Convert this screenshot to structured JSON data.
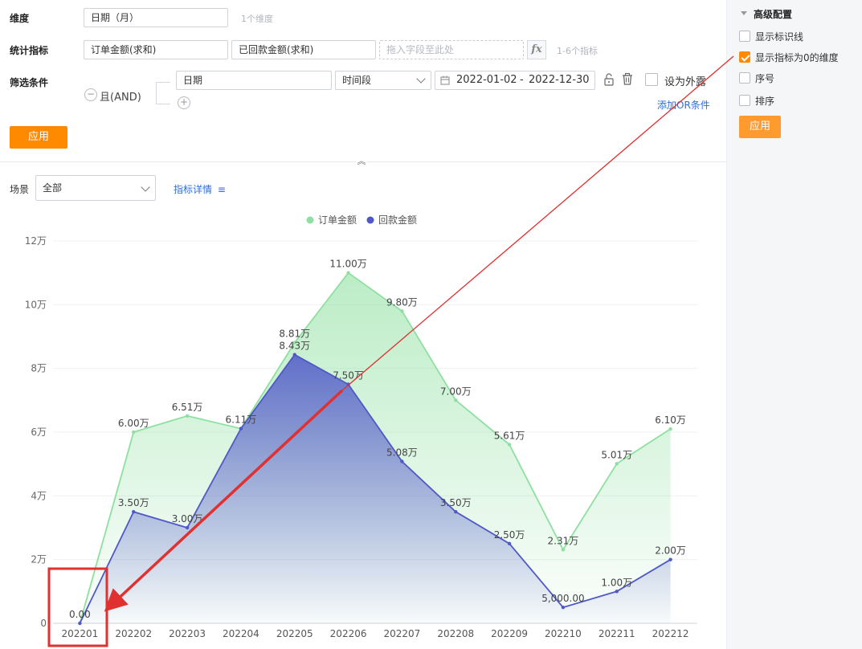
{
  "config": {
    "dimension_label": "维度",
    "dimension_value": "日期（月）",
    "dimension_hint": "1个维度",
    "metric_label": "统计指标",
    "metrics": [
      "订单金额(求和)",
      "已回款金额(求和)"
    ],
    "metric_drop_placeholder": "拖入字段至此处",
    "fx_label": "fx",
    "metric_hint": "1-6个指标",
    "filter_label": "筛选条件",
    "and_label": "且(AND)",
    "minus_symbol": "−",
    "plus_symbol": "+",
    "filter_field": "日期",
    "filter_op": "时间段",
    "date_start": "2022-01-02",
    "date_sep": "-",
    "date_end": "2022-12-30",
    "expose_label": "设为外露",
    "add_or_label": "添加OR条件",
    "apply_label": "应用",
    "collapse_symbol": "︽"
  },
  "toolbar": {
    "scene_label": "场景",
    "scene_value": "全部",
    "metric_detail_label": "指标详情",
    "metric_detail_icon": "≡"
  },
  "advanced": {
    "title": "高级配置",
    "options": [
      {
        "label": "显示标识线",
        "checked": false
      },
      {
        "label": "显示指标为0的维度",
        "checked": true
      },
      {
        "label": "序号",
        "checked": false
      },
      {
        "label": "排序",
        "checked": false
      }
    ],
    "apply_label": "应用"
  },
  "colors": {
    "accent": "#ff8a00",
    "series_green": "#8ee0a0",
    "series_blue": "#5058c8",
    "annotation_red": "#e03030"
  },
  "chart_data": {
    "type": "area",
    "categories": [
      "202201",
      "202202",
      "202203",
      "202204",
      "202205",
      "202206",
      "202207",
      "202208",
      "202209",
      "202210",
      "202211",
      "202212"
    ],
    "series": [
      {
        "name": "订单金额",
        "values": [
          0,
          6.0,
          6.51,
          6.11,
          8.81,
          11.0,
          9.8,
          7.0,
          5.61,
          2.31,
          5.01,
          6.1
        ],
        "labels": [
          "",
          "6.00万",
          "6.51万",
          "6.11万",
          "8.81万",
          "11.00万",
          "9.80万",
          "7.00万",
          "5.61万",
          "2.31万",
          "5.01万",
          "6.10万"
        ]
      },
      {
        "name": "回款金额",
        "values": [
          0,
          3.5,
          3.0,
          6.11,
          8.43,
          7.5,
          5.08,
          3.5,
          2.5,
          0.5,
          1.0,
          2.0
        ],
        "labels": [
          "0.00",
          "3.50万",
          "3.00万",
          "",
          "8.43万",
          "7.50万",
          "5.08万",
          "3.50万",
          "2.50万",
          "5,000.00",
          "1.00万",
          "2.00万"
        ]
      }
    ],
    "y_unit": "万",
    "ylim": [
      0,
      12
    ],
    "y_ticks": [
      "0",
      "2万",
      "4万",
      "6万",
      "8万",
      "10万",
      "12万"
    ],
    "grid": true,
    "legend_position": "top-center"
  }
}
